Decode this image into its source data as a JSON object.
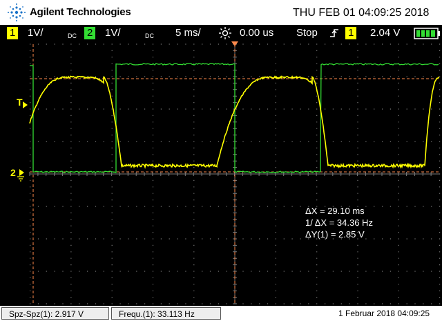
{
  "header": {
    "brand": "Agilent Technologies",
    "datetime": "THU FEB 01 04:09:25 2018"
  },
  "settings": {
    "ch1_num": "1",
    "ch1_scale": "1V/",
    "ch1_coupling": "DC",
    "ch2_num": "2",
    "ch2_scale": "1V/",
    "ch2_coupling": "DC",
    "timebase": "5 ms/",
    "delay": "0.00 us",
    "run_state": "Stop",
    "trigger_source": "1",
    "trigger_level": "2.04 V"
  },
  "markers": {
    "trigger_marker": "T",
    "ch2_marker": "2",
    "ch1_marker": "1"
  },
  "measurements": {
    "dx": "ΔX = 29.10 ms",
    "inv_dx": "1/ ΔX = 34.36 Hz",
    "dy": "ΔY(1) = 2.85 V"
  },
  "footer": {
    "spz": "Spz-Spz(1): 2.917 V",
    "freq": "Frequ.(1): 33.113 Hz",
    "date": "1 Februar 2018  04:09:25"
  },
  "colors": {
    "ch1": "#ffff00",
    "ch2": "#33dd33",
    "cursor": "#ff8a4c",
    "grid": "#7a7a7a",
    "screen_bg": "#000000"
  }
}
